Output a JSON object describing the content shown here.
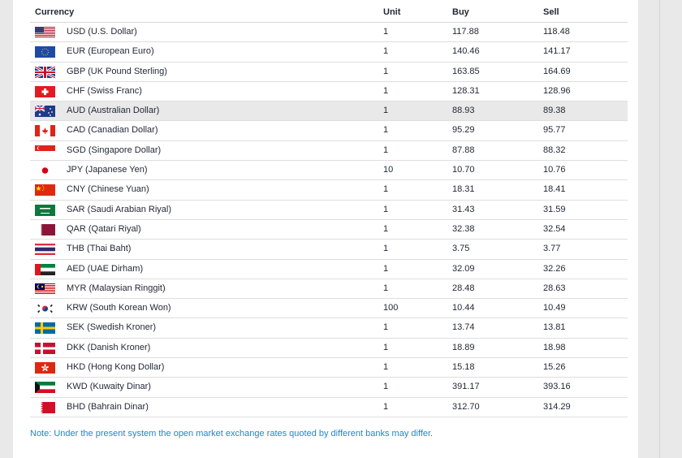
{
  "table": {
    "headers": {
      "currency": "Currency",
      "unit": "Unit",
      "buy": "Buy",
      "sell": "Sell"
    },
    "rows": [
      {
        "name": "USD (U.S. Dollar)",
        "unit": "1",
        "buy": "117.88",
        "sell": "118.48",
        "flag": "usa-flag-icon"
      },
      {
        "name": "EUR (European Euro)",
        "unit": "1",
        "buy": "140.46",
        "sell": "141.17",
        "flag": "eu-flag-icon"
      },
      {
        "name": "GBP (UK Pound Sterling)",
        "unit": "1",
        "buy": "163.85",
        "sell": "164.69",
        "flag": "uk-flag-icon"
      },
      {
        "name": "CHF (Swiss Franc)",
        "unit": "1",
        "buy": "128.31",
        "sell": "128.96",
        "flag": "swiss-flag-icon"
      },
      {
        "name": "AUD (Australian Dollar)",
        "unit": "1",
        "buy": "88.93",
        "sell": "89.38",
        "flag": "australia-flag-icon"
      },
      {
        "name": "CAD (Canadian Dollar)",
        "unit": "1",
        "buy": "95.29",
        "sell": "95.77",
        "flag": "canada-flag-icon"
      },
      {
        "name": "SGD (Singapore Dollar)",
        "unit": "1",
        "buy": "87.88",
        "sell": "88.32",
        "flag": "singapore-flag-icon"
      },
      {
        "name": "JPY (Japanese Yen)",
        "unit": "10",
        "buy": "10.70",
        "sell": "10.76",
        "flag": "japan-flag-icon"
      },
      {
        "name": "CNY (Chinese Yuan)",
        "unit": "1",
        "buy": "18.31",
        "sell": "18.41",
        "flag": "china-flag-icon"
      },
      {
        "name": "SAR (Saudi Arabian Riyal)",
        "unit": "1",
        "buy": "31.43",
        "sell": "31.59",
        "flag": "saudi-flag-icon"
      },
      {
        "name": "QAR (Qatari Riyal)",
        "unit": "1",
        "buy": "32.38",
        "sell": "32.54",
        "flag": "qatar-flag-icon"
      },
      {
        "name": "THB (Thai Baht)",
        "unit": "1",
        "buy": "3.75",
        "sell": "3.77",
        "flag": "thailand-flag-icon"
      },
      {
        "name": "AED (UAE Dirham)",
        "unit": "1",
        "buy": "32.09",
        "sell": "32.26",
        "flag": "uae-flag-icon"
      },
      {
        "name": "MYR (Malaysian Ringgit)",
        "unit": "1",
        "buy": "28.48",
        "sell": "28.63",
        "flag": "malaysia-flag-icon"
      },
      {
        "name": "KRW (South Korean Won)",
        "unit": "100",
        "buy": "10.44",
        "sell": "10.49",
        "flag": "korea-flag-icon"
      },
      {
        "name": "SEK (Swedish Kroner)",
        "unit": "1",
        "buy": "13.74",
        "sell": "13.81",
        "flag": "sweden-flag-icon"
      },
      {
        "name": "DKK (Danish Kroner)",
        "unit": "1",
        "buy": "18.89",
        "sell": "18.98",
        "flag": "denmark-flag-icon"
      },
      {
        "name": "HKD (Hong Kong Dollar)",
        "unit": "1",
        "buy": "15.18",
        "sell": "15.26",
        "flag": "hongkong-flag-icon"
      },
      {
        "name": "KWD (Kuwaity Dinar)",
        "unit": "1",
        "buy": "391.17",
        "sell": "393.16",
        "flag": "kuwait-flag-icon"
      },
      {
        "name": "BHD (Bahrain Dinar)",
        "unit": "1",
        "buy": "312.70",
        "sell": "314.29",
        "flag": "bahrain-flag-icon"
      }
    ],
    "highlighted_row": "AUD (Australian Dollar)"
  },
  "note": "Note: Under the present system the open market exchange rates quoted by different banks may differ.",
  "colors": {
    "note": "#1f86c8",
    "highlight": "#e9e9e9"
  }
}
